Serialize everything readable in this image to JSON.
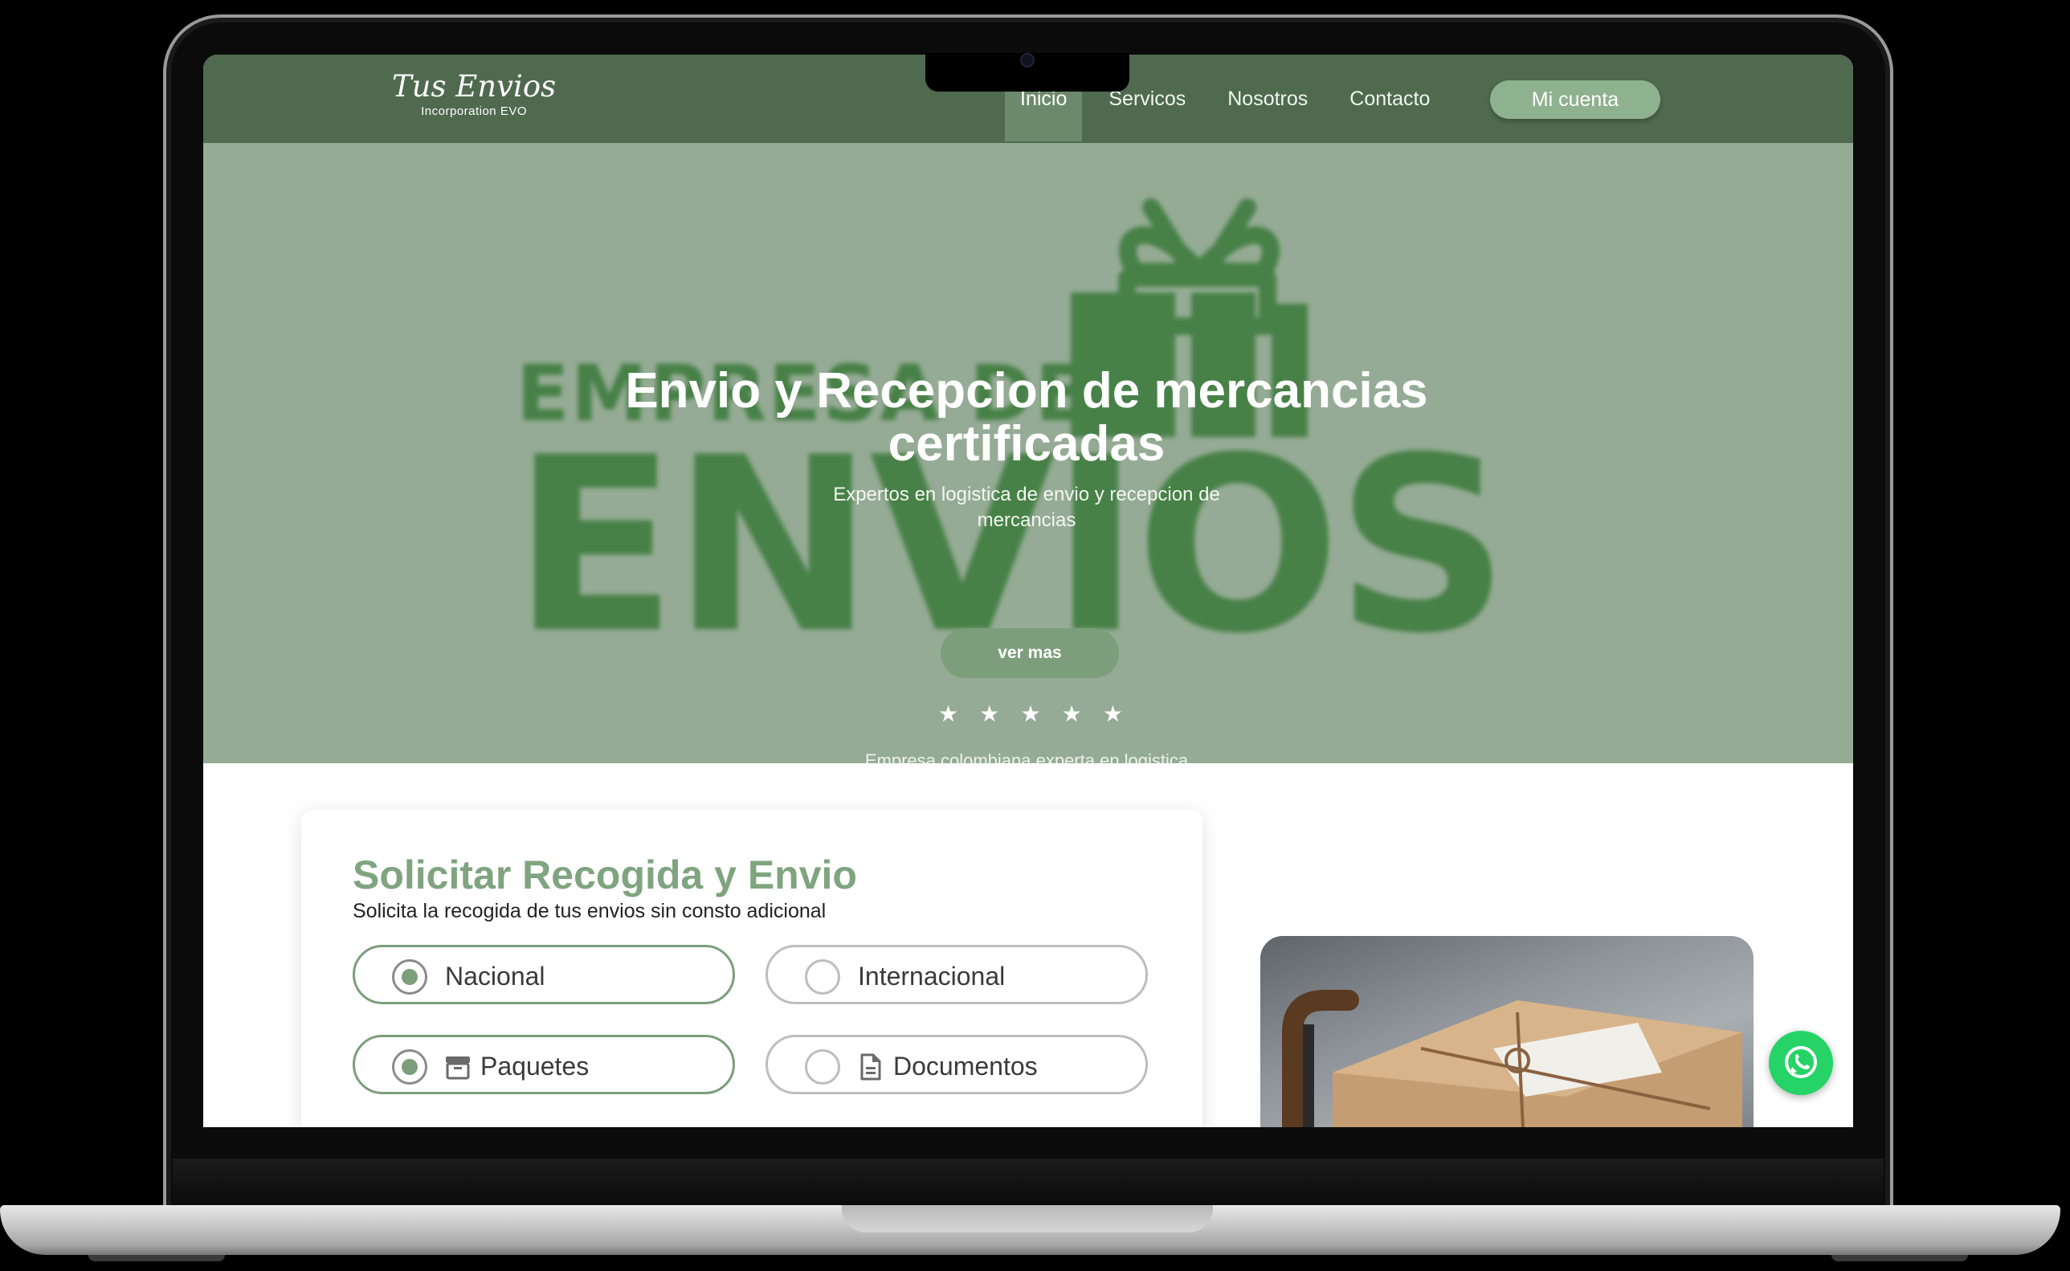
{
  "header": {
    "logo_title": "Tus Envios",
    "logo_subtitle": "Incorporation EVO",
    "nav": [
      "Inicio",
      "Servicos",
      "Nosotros",
      "Contacto"
    ],
    "active_nav": "Inicio",
    "account_button": "Mi cuenta"
  },
  "hero": {
    "background_art_text": "EMPRESA DE ENVIOS",
    "title": "Envio y Recepcion de mercancias certificadas",
    "subtitle": "Expertos en logistica de envio y recepcion de mercancias",
    "button": "ver mas",
    "rating_stars": 5,
    "caption": "Empresa colombiana experta en logistica"
  },
  "request_form": {
    "title": "Solicitar Recogida y Envio",
    "subtitle": "Solicita la recogida de tus envios sin consto adicional",
    "scope_options": [
      {
        "label": "Nacional",
        "selected": true
      },
      {
        "label": "Internacional",
        "selected": false
      }
    ],
    "type_options": [
      {
        "label": "Paquetes",
        "icon": "archive-box-icon",
        "selected": true
      },
      {
        "label": "Documentos",
        "icon": "document-icon",
        "selected": false
      }
    ]
  },
  "floating": {
    "icon": "whatsapp-icon"
  },
  "colors": {
    "header": "#4f6a4f",
    "nav_active": "#6b8a6b",
    "accent": "#7c9e7b",
    "hero_bg": "#96ab96",
    "whatsapp": "#25d366"
  }
}
